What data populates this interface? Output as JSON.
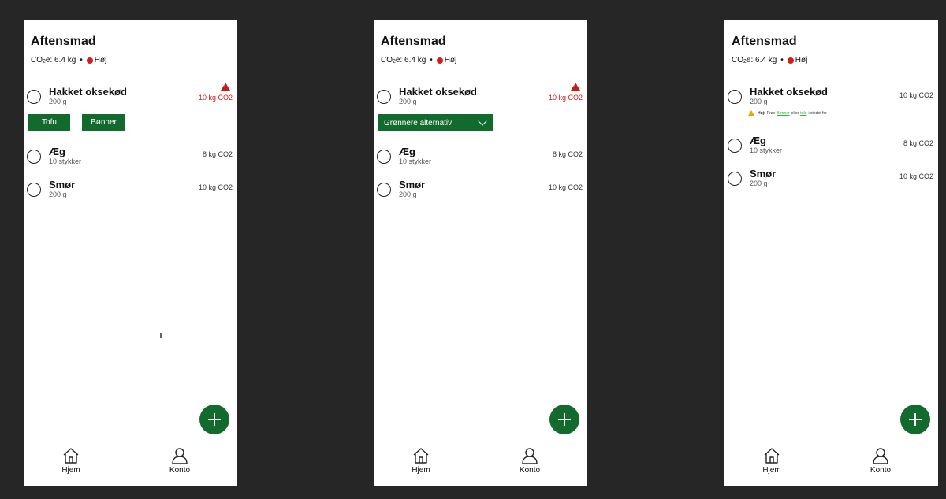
{
  "screens": [
    {
      "title": "Aftensmad",
      "co2_prefix": "CO",
      "co2_sub": "2",
      "co2_suffix": "e: 6.4 kg",
      "separator": "•",
      "level": "Høj",
      "items": [
        {
          "name": "Hakket oksekød",
          "qty": "200 g",
          "co2": "10 kg CO2"
        },
        {
          "name": "Æg",
          "qty": "10 stykker",
          "co2": "8 kg CO2"
        },
        {
          "name": "Smør",
          "qty": "200 g",
          "co2": "10 kg CO2"
        }
      ],
      "alternatives": [
        "Tofu",
        "Bønner"
      ]
    },
    {
      "title": "Aftensmad",
      "co2_prefix": "CO",
      "co2_sub": "2",
      "co2_suffix": "e: 6.4 kg",
      "separator": "•",
      "level": "Høj",
      "items": [
        {
          "name": "Hakket oksekød",
          "qty": "200 g",
          "co2": "10 kg CO2"
        },
        {
          "name": "Æg",
          "qty": "10 stykker",
          "co2": "8 kg CO2"
        },
        {
          "name": "Smør",
          "qty": "200 g",
          "co2": "10 kg CO2"
        }
      ],
      "dropdown_label": "Grønnere alternativ"
    },
    {
      "title": "Aftensmad",
      "co2_prefix": "CO",
      "co2_sub": "2",
      "co2_suffix": "e: 6.4 kg",
      "separator": "•",
      "level": "Høj",
      "items": [
        {
          "name": "Hakket oksekød",
          "qty": "200 g",
          "co2": "10 kg CO2"
        },
        {
          "name": "Æg",
          "qty": "10 stykker",
          "co2": "8 kg CO2"
        },
        {
          "name": "Smør",
          "qty": "200 g",
          "co2": "10 kg CO2"
        }
      ],
      "tip": {
        "bold": "Høj:",
        "pre": "Prøv",
        "link1": "Bønner",
        "mid": "eller",
        "link2": "tofu",
        "post": "i stedet for"
      }
    }
  ],
  "nav": {
    "home": "Hjem",
    "account": "Konto"
  },
  "icons": {
    "add": "plus-icon",
    "home": "home-icon",
    "account": "user-icon",
    "warning": "warning-icon",
    "checkbox": "circle-checkbox-icon"
  },
  "colors": {
    "accent": "#136a2d",
    "warning_red": "#d01c1c",
    "tip_yellow": "#e8a800",
    "link_green": "#2bbd2b"
  }
}
